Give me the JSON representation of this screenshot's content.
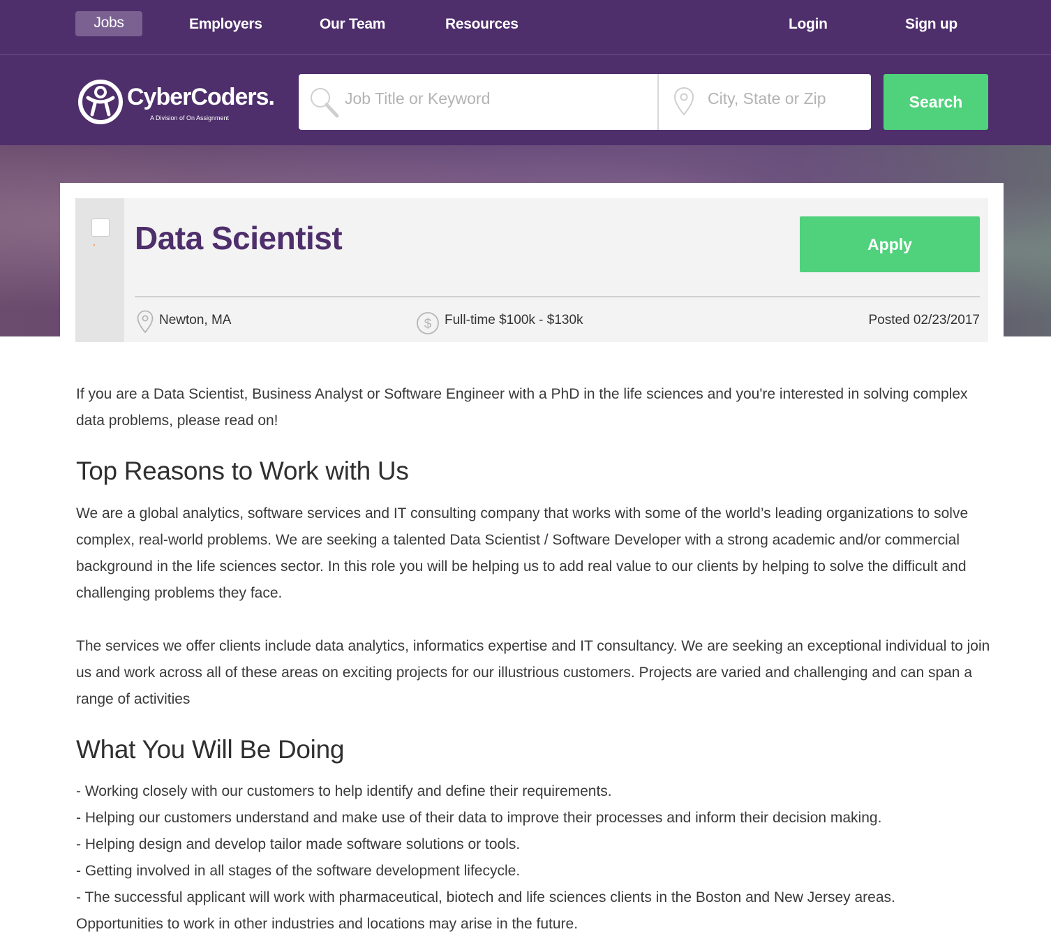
{
  "nav": {
    "jobs": "Jobs",
    "employers": "Employers",
    "our_team": "Our Team",
    "resources": "Resources",
    "login": "Login",
    "signup": "Sign up"
  },
  "logo": {
    "name": "CyberCoders.",
    "subtitle": "A Division of On Assignment"
  },
  "search": {
    "keyword_placeholder": "Job Title or Keyword",
    "location_placeholder": "City, State or Zip",
    "button_label": "Search"
  },
  "job": {
    "title": "Data Scientist",
    "apply_label": "Apply",
    "location": "Newton, MA",
    "salary": "Full-time $100k - $130k",
    "posted": "Posted 02/23/2017"
  },
  "description": {
    "intro": "If you are a Data Scientist, Business Analyst or Software Engineer with a PhD in the life sciences and you're interested in solving complex data problems, please read on!",
    "reasons_heading": "Top Reasons to Work with Us",
    "reasons_p1": "We are a global analytics, software services and IT consulting company that works with some of the world’s leading organizations to solve complex, real-world problems. We are seeking a talented Data Scientist / Software Developer with a strong academic and/or commercial background in the life sciences sector. In this role you will be helping us to add real value to our clients by helping to solve the difficult and challenging problems they face.",
    "reasons_p2": "The services we offer clients include data analytics, informatics expertise and IT consultancy. We are seeking an exceptional individual to join us and work across all of these areas on exciting projects for our illustrious customers. Projects are varied and challenging and can span a range of activities",
    "doing_heading": "What You Will Be Doing",
    "doing_items": [
      "- Working closely with our customers to help identify and define their requirements.",
      "- Helping our customers understand and make use of their data to improve their processes and inform their decision making.",
      "- Helping design and develop tailor made software solutions or tools.",
      "- Getting involved in all stages of the software development lifecycle.",
      "- The successful applicant will work with pharmaceutical, biotech and life sciences clients in the Boston and New Jersey areas.",
      "Opportunities to work in other industries and locations may arise in the future."
    ]
  },
  "colors": {
    "brand_purple": "#4e2e6b",
    "accent_green": "#4fd27b"
  },
  "icons": [
    "search-icon",
    "location-pin-icon",
    "dollar-icon",
    "logo-icon"
  ]
}
